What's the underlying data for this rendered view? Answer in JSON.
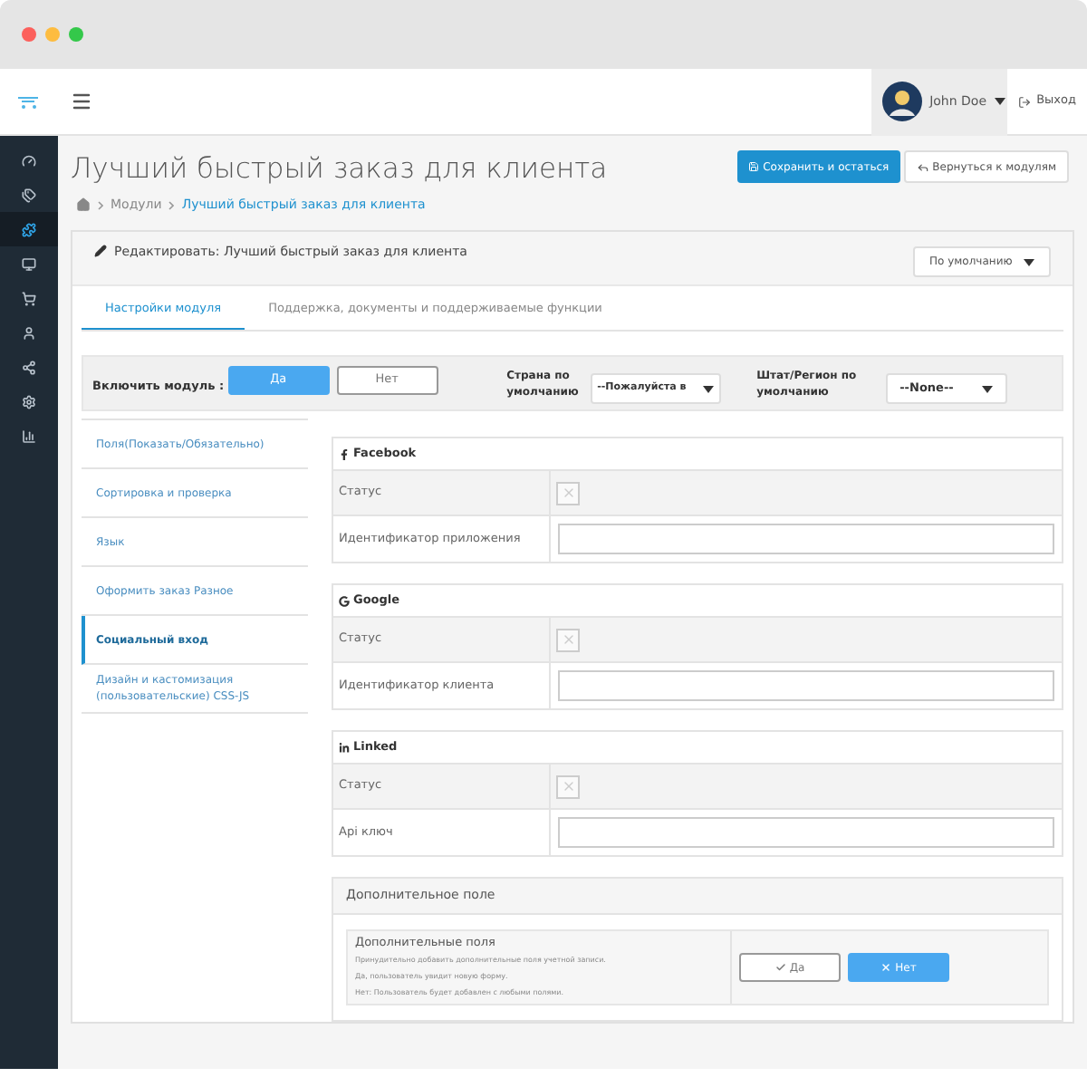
{
  "header": {
    "user": {
      "name": "John Doe"
    },
    "logout": "Выход"
  },
  "sidebar": {
    "items": [
      {
        "kind": "dashboard",
        "selected": false
      },
      {
        "kind": "tags",
        "selected": false
      },
      {
        "kind": "puzzle",
        "selected": true
      },
      {
        "kind": "monitor",
        "selected": false
      },
      {
        "kind": "cart",
        "selected": false
      },
      {
        "kind": "user",
        "selected": false
      },
      {
        "kind": "share",
        "selected": false
      },
      {
        "kind": "settings",
        "selected": false
      },
      {
        "kind": "chart",
        "selected": false
      }
    ]
  },
  "page": {
    "title": "Лучший быстрый заказ для клиента",
    "actions": [
      {
        "kind": "save",
        "label": "Сохранить и остаться"
      },
      {
        "kind": "back",
        "label": "Вернуться к модулям"
      }
    ],
    "breadcrumbs": [
      {
        "label": "Модули",
        "current": false
      },
      {
        "label": "Лучший быстрый заказ для клиента",
        "current": true
      }
    ]
  },
  "panel": {
    "title": "Редактировать: Лучший быстрый заказ для клиента",
    "store_select": {
      "value": "По умолчанию"
    },
    "tabs": [
      {
        "label": "Настройки модуля",
        "selected": true
      },
      {
        "label": "Поддержка, документы и поддерживаемые функции",
        "selected": false
      }
    ],
    "enable": {
      "label": "Включить модуль :",
      "options": [
        {
          "label": "Да",
          "selected": true
        },
        {
          "label": "Нет",
          "selected": false
        }
      ]
    },
    "country": {
      "label": "Страна по умолчанию",
      "value": "--Пожалуйста в"
    },
    "region": {
      "label": "Штат/Регион по умолчанию",
      "value": "--None--"
    },
    "nav": [
      {
        "label": "Поля(Показать/Обязательно)",
        "selected": false
      },
      {
        "label": "Сортировка и проверка",
        "selected": false
      },
      {
        "label": "Язык",
        "selected": false
      },
      {
        "label": "Оформить заказ Разное",
        "selected": false
      },
      {
        "label": "Социальный вход",
        "selected": true
      },
      {
        "label": "Дизайн и кастомизация (пользовательские) CSS-JS",
        "selected": false
      }
    ],
    "sections": [
      {
        "kind": "facebook",
        "title": "Facebook",
        "rows": [
          {
            "kind": "toggle",
            "label": "Статус",
            "checked": false
          },
          {
            "kind": "input",
            "label": "Идентификатор приложения"
          }
        ]
      },
      {
        "kind": "google",
        "title": "Google",
        "rows": [
          {
            "kind": "toggle",
            "label": "Статус",
            "checked": false
          },
          {
            "kind": "input",
            "label": "Идентификатор клиента"
          }
        ]
      },
      {
        "kind": "linkedin",
        "title": "Linked",
        "rows": [
          {
            "kind": "toggle",
            "label": "Статус",
            "checked": false
          },
          {
            "kind": "input",
            "label": "Api ключ"
          }
        ]
      }
    ],
    "extra": {
      "title": "Дополнительное поле",
      "label": "Дополнительные поля",
      "help": [
        "Принудительно добавить дополнительные поля учетной записи.",
        "Да, пользователь увидит новую форму.",
        "Нет: Пользователь будет добавлен с любыми полями."
      ],
      "options": [
        {
          "label": "Да",
          "selected": false
        },
        {
          "label": "Нет",
          "selected": true
        }
      ]
    }
  }
}
